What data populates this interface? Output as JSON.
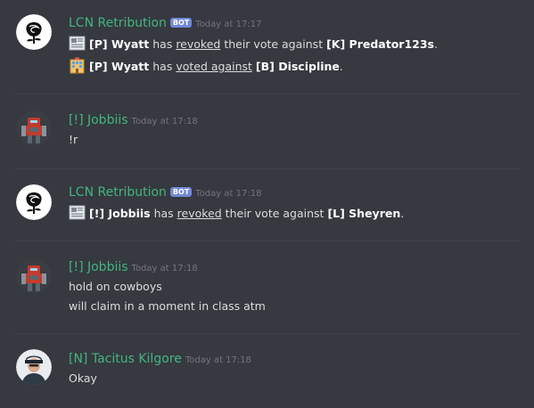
{
  "messages": [
    {
      "author": "LCN Retribution",
      "bot_tag": "BOT",
      "timestamp": "Today at 17:17",
      "lines": [
        {
          "emoji": "newspaper-icon",
          "tag": "[P] Wyatt",
          "pre": " has ",
          "action": "revoked",
          "mid": " their vote against ",
          "target": "[K] Predator123s",
          "end": "."
        },
        {
          "emoji": "office-building-icon",
          "tag": "[P] Wyatt",
          "pre": " has ",
          "action": "voted against",
          "mid": " ",
          "target": "[B] Discipline",
          "end": "."
        }
      ]
    },
    {
      "author": "[!] Jobbiis",
      "timestamp": "Today at 17:18",
      "lines": [
        {
          "text": "!r"
        }
      ]
    },
    {
      "author": "LCN Retribution",
      "bot_tag": "BOT",
      "timestamp": "Today at 17:18",
      "lines": [
        {
          "emoji": "newspaper-icon",
          "tag": "[!] Jobbiis",
          "pre": " has ",
          "action": "revoked",
          "mid": " their vote against ",
          "target": "[L] Sheyren",
          "end": "."
        }
      ]
    },
    {
      "author": "[!] Jobbiis",
      "timestamp": "Today at 17:18",
      "lines": [
        {
          "text": "hold on cowboys"
        },
        {
          "text": "will claim in a moment in class atm"
        }
      ]
    },
    {
      "author": "[N] Tacitus Kilgore",
      "timestamp": "Today at 17:18",
      "lines": [
        {
          "text": "Okay"
        }
      ]
    }
  ],
  "colors": {
    "background": "#36393f",
    "username": "#43b581",
    "bot_tag": "#7289da",
    "text": "#dcddde",
    "timestamp": "#72767d"
  }
}
